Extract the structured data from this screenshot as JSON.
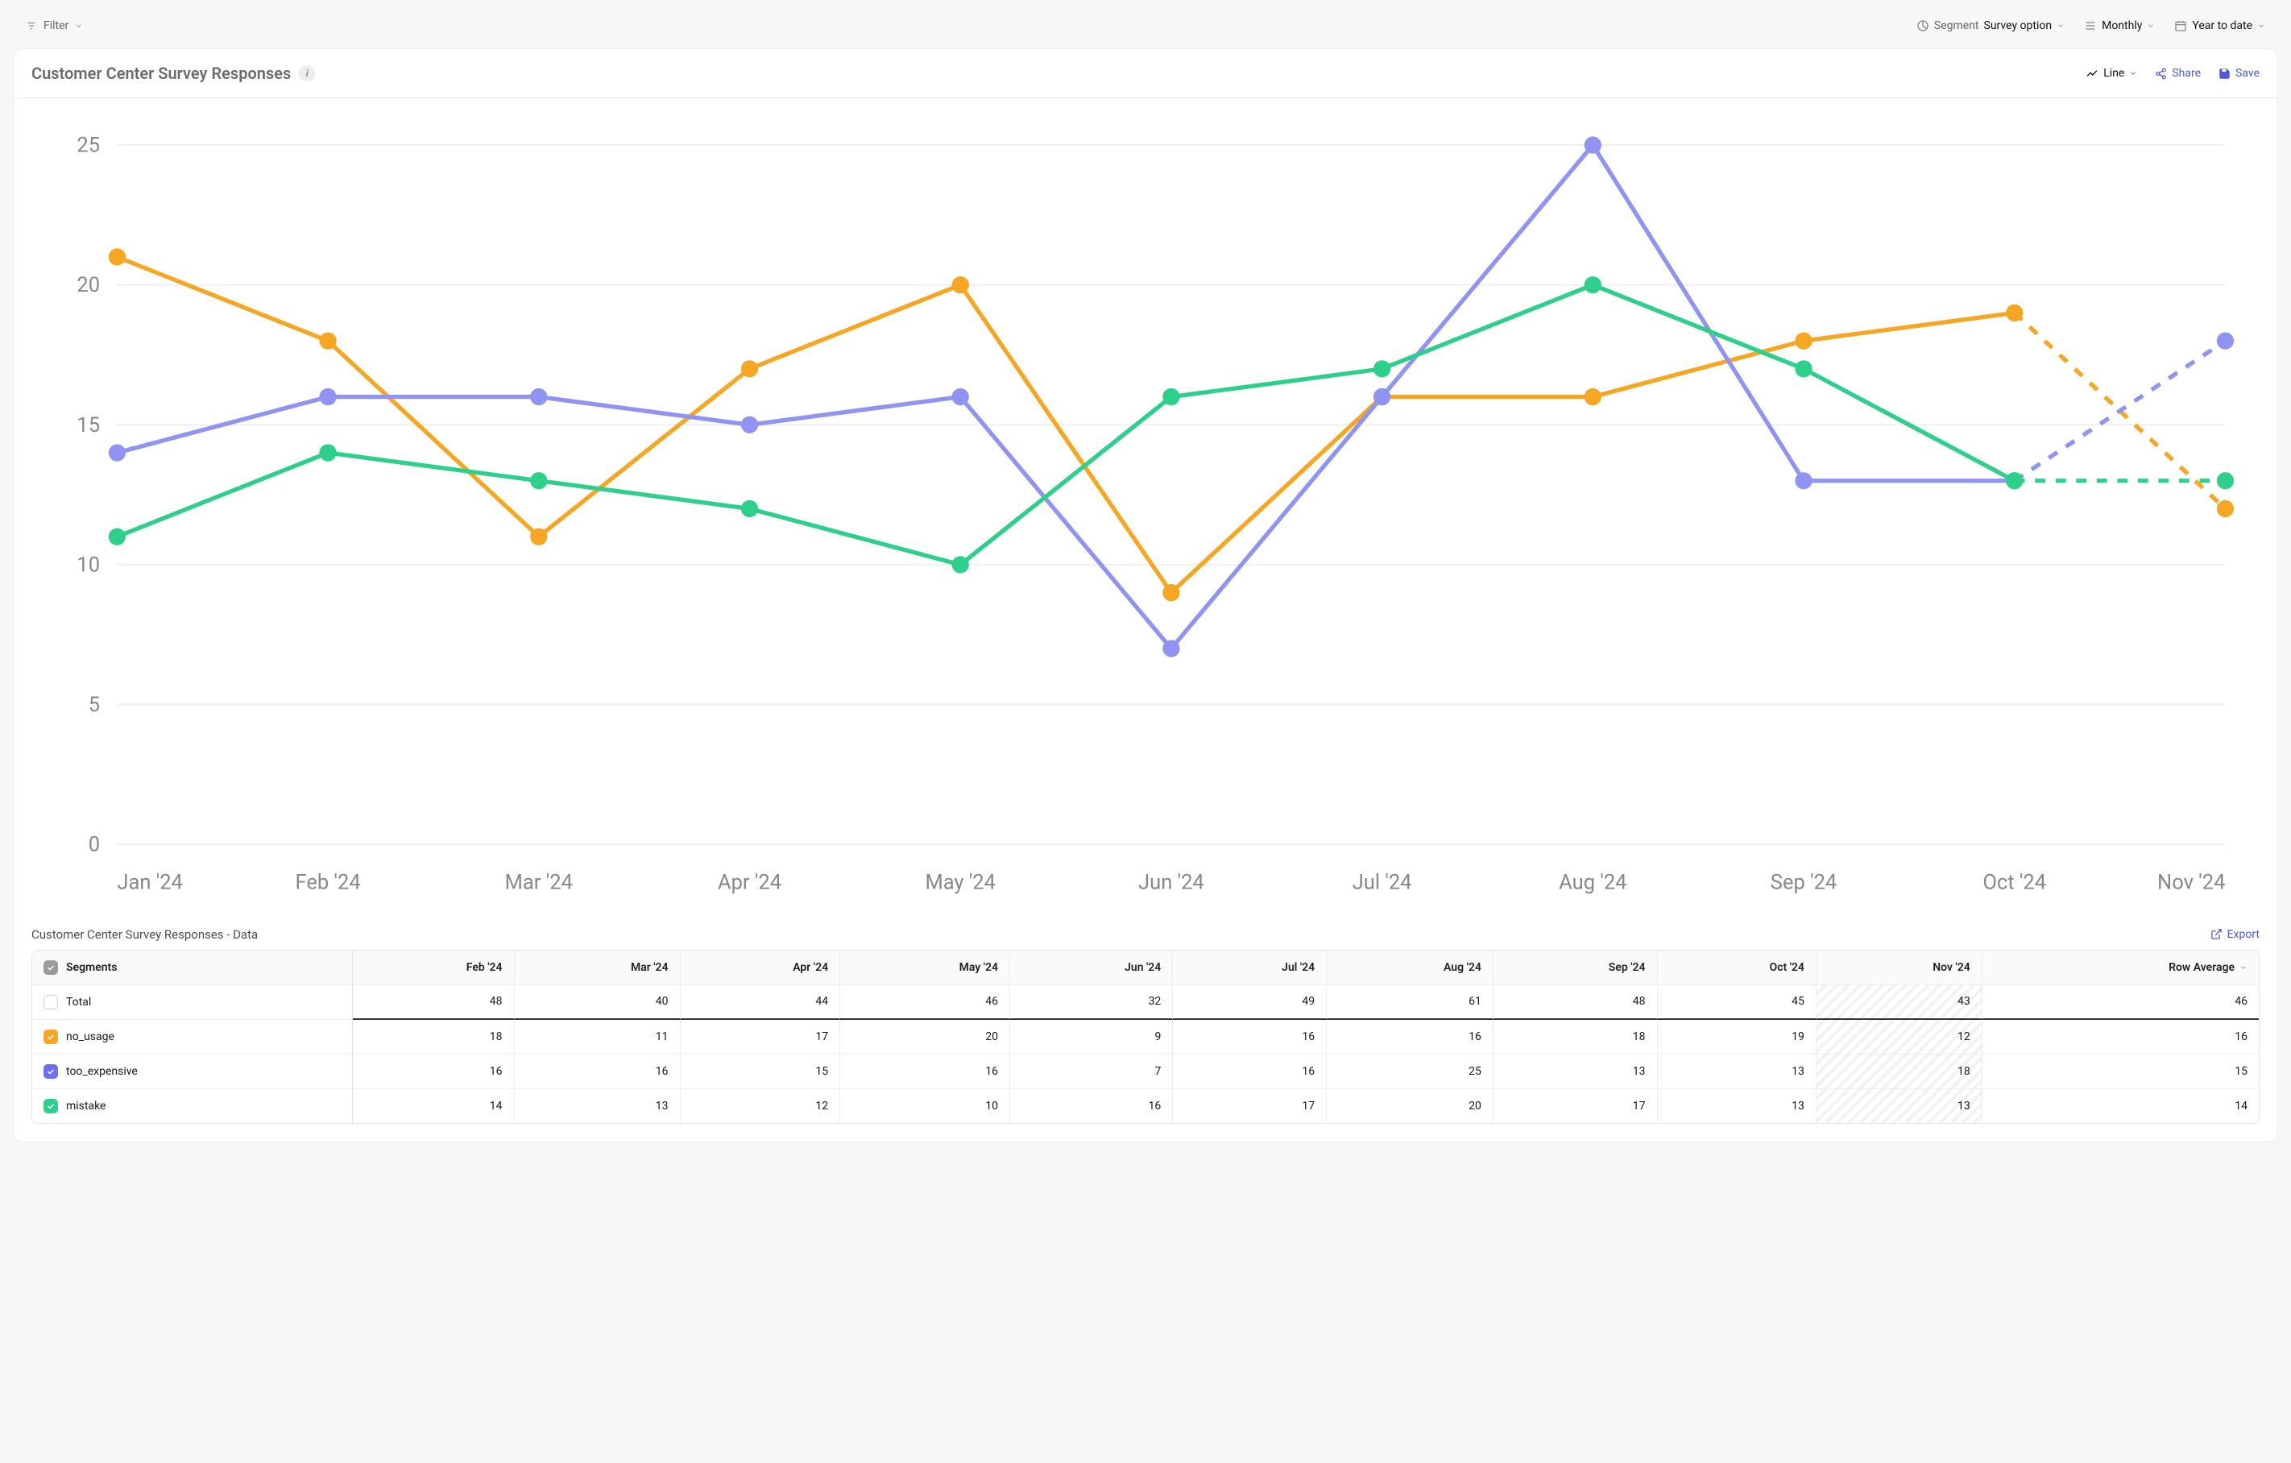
{
  "toolbar": {
    "filter_label": "Filter",
    "segment_label": "Segment",
    "segment_value": "Survey option",
    "granularity": "Monthly",
    "range": "Year to date"
  },
  "card": {
    "title": "Customer Center Survey Responses",
    "chart_type_label": "Line",
    "share_label": "Share",
    "save_label": "Save"
  },
  "subhead": {
    "title": "Customer Center Survey Responses - Data",
    "export_label": "Export"
  },
  "table": {
    "segments_header": "Segments",
    "rowavg_header": "Row Average",
    "months": [
      "Feb '24",
      "Mar '24",
      "Apr '24",
      "May '24",
      "Jun '24",
      "Jul '24",
      "Aug '24",
      "Sep '24",
      "Oct '24",
      "Nov '24"
    ],
    "rows": [
      {
        "key": "total",
        "label": "Total",
        "checked": false,
        "vals": [
          48,
          40,
          44,
          46,
          32,
          49,
          61,
          48,
          45,
          43
        ],
        "avg": 46
      },
      {
        "key": "no_usage",
        "label": "no_usage",
        "checked": true,
        "color": "orange",
        "vals": [
          18,
          11,
          17,
          20,
          9,
          16,
          16,
          18,
          19,
          12
        ],
        "avg": 16
      },
      {
        "key": "too_expensive",
        "label": "too_expensive",
        "checked": true,
        "color": "purple",
        "vals": [
          16,
          16,
          15,
          16,
          7,
          16,
          25,
          13,
          13,
          18
        ],
        "avg": 15
      },
      {
        "key": "mistake",
        "label": "mistake",
        "checked": true,
        "color": "green",
        "vals": [
          14,
          13,
          12,
          10,
          16,
          17,
          20,
          17,
          13,
          13
        ],
        "avg": 14
      }
    ]
  },
  "chart_data": {
    "type": "line",
    "title": "Customer Center Survey Responses",
    "xlabel": "",
    "ylabel": "",
    "ylim": [
      0,
      25
    ],
    "yticks": [
      0,
      5,
      10,
      15,
      20,
      25
    ],
    "categories": [
      "Jan '24",
      "Feb '24",
      "Mar '24",
      "Apr '24",
      "May '24",
      "Jun '24",
      "Jul '24",
      "Aug '24",
      "Sep '24",
      "Oct '24",
      "Nov '24"
    ],
    "series": [
      {
        "name": "no_usage",
        "color": "#f5a623",
        "values": [
          21,
          18,
          11,
          17,
          20,
          9,
          16,
          16,
          18,
          19,
          12
        ]
      },
      {
        "name": "too_expensive",
        "color": "#8f94f3",
        "values": [
          14,
          16,
          16,
          15,
          16,
          7,
          16,
          25,
          13,
          13,
          18
        ]
      },
      {
        "name": "mistake",
        "color": "#2dcf8a",
        "values": [
          11,
          14,
          13,
          12,
          10,
          16,
          17,
          20,
          17,
          13,
          13
        ]
      }
    ],
    "dashed_last_segment": true
  },
  "colors": {
    "orange": "#f5a623",
    "purple": "#8f94f3",
    "green": "#2dcf8a",
    "link": "#4f57e4"
  }
}
